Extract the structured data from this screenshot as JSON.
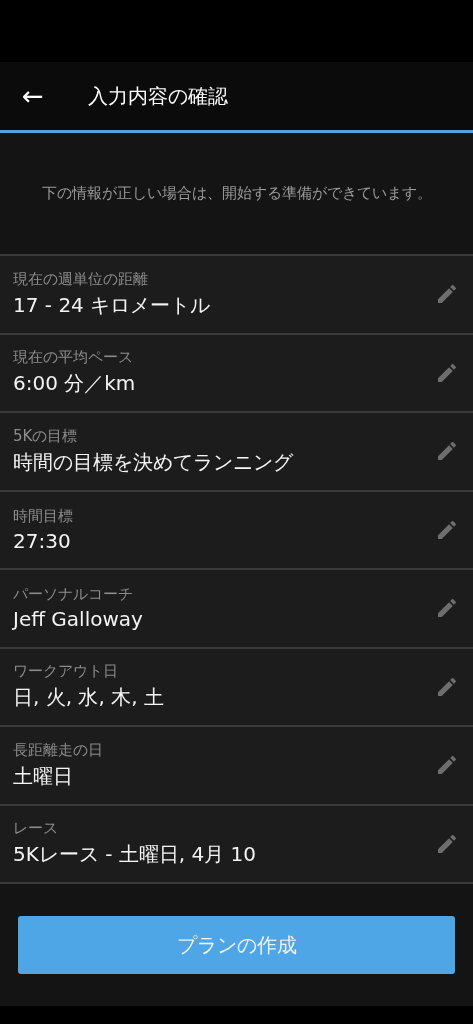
{
  "header": {
    "back_icon": "←",
    "title": "入力内容の確認"
  },
  "intro": "下の情報が正しい場合は、開始する準備ができています。",
  "items": [
    {
      "label": "現在の週単位の距離",
      "value": "17 - 24 キロメートル"
    },
    {
      "label": "現在の平均ペース",
      "value": "6:00 分／km"
    },
    {
      "label": "5Kの目標",
      "value": "時間の目標を決めてランニング"
    },
    {
      "label": "時間目標",
      "value": "27:30"
    },
    {
      "label": "パーソナルコーチ",
      "value": "Jeff Galloway"
    },
    {
      "label": "ワークアウト日",
      "value": "日, 火, 水, 木, 土"
    },
    {
      "label": "長距離走の日",
      "value": "土曜日"
    },
    {
      "label": "レース",
      "value": "5Kレース - 土曜日, 4月 10"
    }
  ],
  "button": "プランの作成"
}
